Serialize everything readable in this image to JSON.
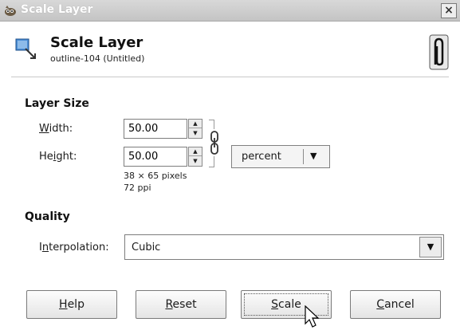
{
  "window": {
    "title": "Scale Layer",
    "close_label": "×"
  },
  "header": {
    "title": "Scale Layer",
    "subtitle": "outline-104 (Untitled)"
  },
  "layer_size": {
    "section_label": "Layer Size",
    "width": {
      "label_pre": "",
      "label_u": "W",
      "label_post": "idth:",
      "value": "50.00"
    },
    "height": {
      "label_pre": "He",
      "label_u": "i",
      "label_post": "ght:",
      "value": "50.00"
    },
    "chain_linked": true,
    "unit": "percent",
    "pixel_info": "38 × 65 pixels",
    "resolution_info": "72 ppi"
  },
  "quality": {
    "section_label": "Quality",
    "interp_label_pre": "I",
    "interp_label_u": "n",
    "interp_label_post": "terpolation:",
    "interpolation": "Cubic"
  },
  "buttons": {
    "help": {
      "u": "H",
      "rest": "elp"
    },
    "reset": {
      "u": "R",
      "rest": "eset"
    },
    "scale": {
      "u": "S",
      "rest": "cale"
    },
    "cancel": {
      "u": "C",
      "rest": "ancel"
    }
  },
  "colors": {
    "titlebar_text": "#ffffff",
    "titlebar_bg": "#cccccc"
  },
  "icons": {
    "app": "gimp-icon",
    "header": "scale-layer-icon",
    "clip": "paperclip-icon",
    "chain": "chain-link-icon",
    "cursor": "mouse-pointer-icon"
  }
}
